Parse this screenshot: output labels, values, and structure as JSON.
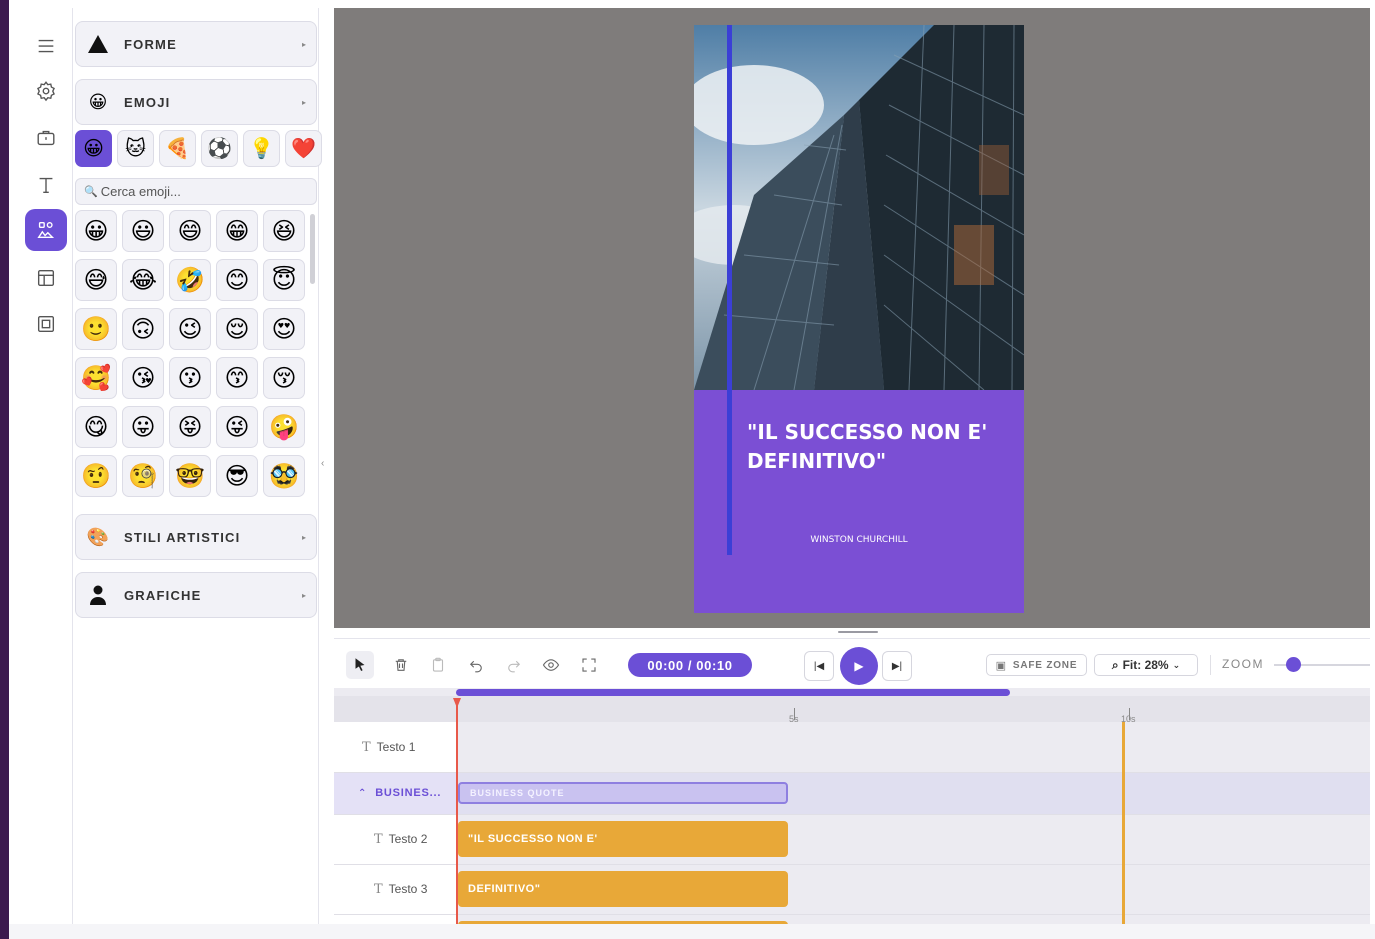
{
  "sidebar": {
    "sections": {
      "shapes": "FORME",
      "emoji": "EMOJI",
      "art_styles": "STILI ARTISTICI",
      "graphics": "GRAFICHE"
    },
    "emoji_categories": [
      "😀",
      "🐱",
      "🍕",
      "⚽",
      "💡",
      "❤️"
    ],
    "search_placeholder": "Cerca emoji...",
    "emojis": [
      "😀",
      "😃",
      "😄",
      "😁",
      "😆",
      "😅",
      "😂",
      "🤣",
      "😊",
      "😇",
      "🙂",
      "🙃",
      "😉",
      "😌",
      "😍",
      "🥰",
      "😘",
      "😗",
      "😙",
      "😚",
      "😋",
      "😛",
      "😝",
      "😜",
      "🤪",
      "🤨",
      "🧐",
      "🤓",
      "😎",
      "🥸"
    ],
    "art_styles_icon": "🎨"
  },
  "canvas": {
    "quote": "\"IL SUCCESSO NON E' DEFINITIVO\"",
    "author": "WINSTON CHURCHILL"
  },
  "toolbar": {
    "time": "00:00 / 00:10",
    "safe_zone": "SAFE ZONE",
    "fit": "Fit: 28%",
    "zoom": "ZOOM"
  },
  "timeline": {
    "ticks": [
      "5s",
      "10s"
    ],
    "rows": [
      {
        "label": "Testo 1"
      },
      {
        "label": "BUSINES..."
      },
      {
        "label": "Testo 2"
      },
      {
        "label": "Testo 3"
      }
    ],
    "clips": {
      "group": "BUSINESS QUOTE",
      "testo2": "\"IL SUCCESSO NON E'",
      "testo3": "DEFINITIVO\""
    }
  },
  "colors": {
    "accent": "#6b4fd6",
    "story_bg": "#7b4fd4",
    "clip_orange": "#e8a838",
    "playhead": "#e8594a"
  }
}
